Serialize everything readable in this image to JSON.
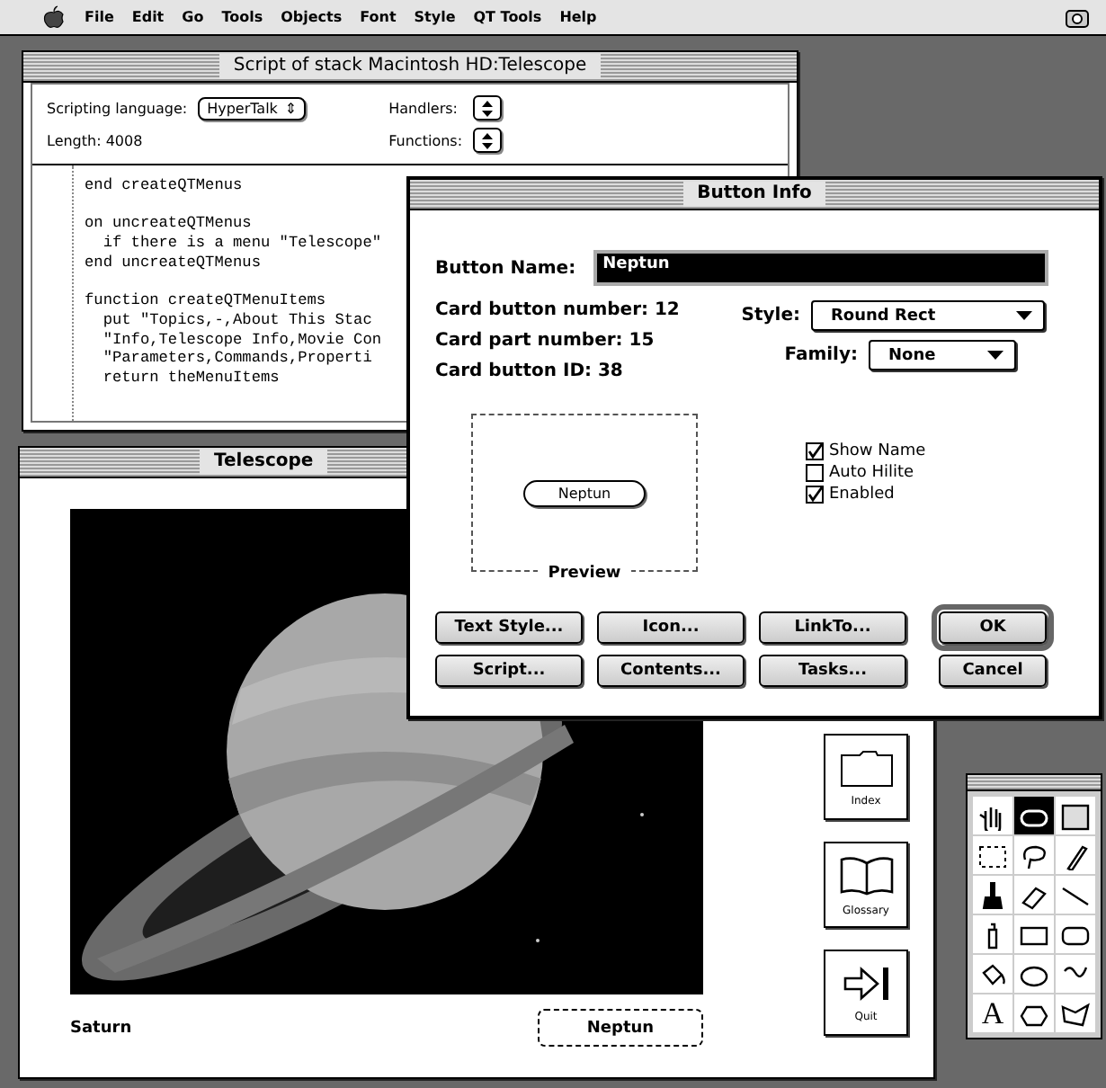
{
  "menu_bar": {
    "items": [
      "File",
      "Edit",
      "Go",
      "Tools",
      "Objects",
      "Font",
      "Style",
      "QT Tools",
      "Help"
    ]
  },
  "script_window": {
    "title": "Script of stack Macintosh HD:Telescope",
    "language_label": "Scripting language:",
    "language": "HyperTalk",
    "length": "Length: 4008",
    "handlers_label": "Handlers:",
    "functions_label": "Functions:",
    "language_arrow": "⇕",
    "blocks": [
      [
        "end createQTMenus"
      ],
      [
        "on uncreateQTMenus",
        "  if there is a menu \"Telescope\"",
        "end uncreateQTMenus"
      ],
      [
        "function createQTMenuItems",
        "  put \"Topics,-,About This Stac",
        "  \"Info,Telescope Info,Movie Con",
        "  \"Parameters,Commands,Properti",
        "  return theMenuItems"
      ]
    ]
  },
  "telescope_window": {
    "title": "Telescope",
    "caption": "Saturn",
    "button": "Neptun",
    "nav_buttons": [
      {
        "kind": "folder",
        "label": "Index"
      },
      {
        "kind": "book",
        "label": "Glossary"
      },
      {
        "kind": "exit",
        "label": "Quit"
      }
    ]
  },
  "dialog": {
    "title": "Button Info",
    "name_label": "Button Name:",
    "name": "Neptun",
    "info": [
      "Card button number: 12",
      "Card part number: 15",
      "Card button ID: 38"
    ],
    "style_label": "Style:",
    "style": "Round Rect",
    "family_label": "Family:",
    "family": "None",
    "preview_label": "Preview",
    "preview_button": "Neptun",
    "checkboxes": [
      {
        "label": "Show Name",
        "checked": true
      },
      {
        "label": "Auto Hilite",
        "checked": false
      },
      {
        "label": "Enabled",
        "checked": true
      }
    ],
    "buttons": [
      {
        "label": "Text Style...",
        "default": false
      },
      {
        "label": "Icon...",
        "default": false
      },
      {
        "label": "LinkTo...",
        "default": false
      },
      {
        "label": "OK",
        "default": true
      },
      {
        "label": "Script...",
        "default": false
      },
      {
        "label": "Contents...",
        "default": false
      },
      {
        "label": "Tasks...",
        "default": false
      },
      {
        "label": "Cancel",
        "default": false
      }
    ]
  },
  "tools_palette": {
    "tools": [
      {
        "kind": "browse",
        "selected": false
      },
      {
        "kind": "button",
        "selected": true
      },
      {
        "kind": "field",
        "selected": false
      },
      {
        "kind": "select",
        "selected": false
      },
      {
        "kind": "lasso",
        "selected": false
      },
      {
        "kind": "pencil",
        "selected": false
      },
      {
        "kind": "brush",
        "selected": false
      },
      {
        "kind": "eraser",
        "selected": false
      },
      {
        "kind": "line",
        "selected": false
      },
      {
        "kind": "spray",
        "selected": false
      },
      {
        "kind": "rect",
        "selected": false
      },
      {
        "kind": "roundrect",
        "selected": false
      },
      {
        "kind": "bucket",
        "selected": false
      },
      {
        "kind": "oval",
        "selected": false
      },
      {
        "kind": "curve",
        "selected": false
      },
      {
        "kind": "text",
        "selected": false,
        "glyph": "A"
      },
      {
        "kind": "polygon",
        "selected": false
      },
      {
        "kind": "freepolygon",
        "selected": false
      }
    ]
  }
}
